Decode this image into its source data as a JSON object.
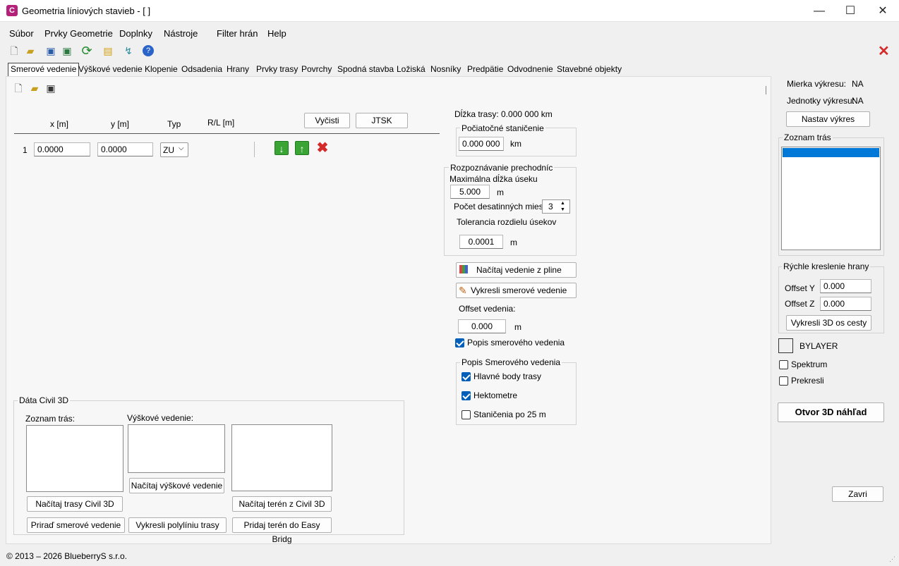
{
  "window": {
    "title": "Geometria líniových stavieb - [ ]",
    "app_icon_text": "C",
    "minimize": "—",
    "maximize": "☐",
    "close": "✕"
  },
  "menu": [
    "Súbor",
    "Prvky Geometrie",
    "Doplnky",
    "Nástroje",
    "Filter hrán",
    "Help"
  ],
  "tabs": [
    "Smerové vedenie",
    "Výškové vedenie",
    "Klopenie",
    "Odsadenia",
    "Hrany",
    "Prvky trasy",
    "Povrchy",
    "Spodná stavba",
    "Ložiská",
    "Nosníky",
    "Predpätie",
    "Odvodnenie",
    "Stavebné objekty"
  ],
  "table": {
    "headers": {
      "x": "x [m]",
      "y": "y  [m]",
      "typ": "Typ",
      "rl": "R/L [m]"
    },
    "rows": [
      {
        "index": "1",
        "x": "0.0000",
        "y": "0.0000",
        "typ": "ZU"
      }
    ],
    "clear_button": "Vyčisti",
    "jtsk_button": "JTSK"
  },
  "trasa": {
    "dlzka": "Dĺžka trasy: 0.000 000 km",
    "pociatocne_title": "Počiatočné staničenie",
    "pociatocne_value": "0.000 000",
    "pociatocne_unit": "km"
  },
  "rozpoznavanie": {
    "title": "Rozpoznávanie prechodníc",
    "max_label": "Maximálna dĺžka úseku",
    "max_value": "5.000",
    "max_unit": "m",
    "desatinne_label": "Počet desatinných miest",
    "desatinne_value": "3",
    "tolerancia_label": "Tolerancia rozdielu úsekov",
    "tolerancia_value": "0.0001",
    "tolerancia_unit": "m"
  },
  "actions": {
    "nacitaj_pline": "Načítaj vedenie z pline",
    "vykresli_smerove": "Vykresli smerové vedenie",
    "offset_label": "Offset vedenia:",
    "offset_value": "0.000",
    "offset_unit": "m",
    "popis_checkbox": "Popis smerového vedenia"
  },
  "popis_group": {
    "title": "Popis Smerového vedenia",
    "hlavne": "Hlavné body trasy",
    "hektometre": "Hektometre",
    "stanicenia": "Staničenia po 25 m"
  },
  "civil3d": {
    "title": "Dáta Civil 3D",
    "zoznam_label": "Zoznam trás:",
    "vyskove_label": "Výškové vedenie:",
    "nacitaj_vyskove": "Načítaj výškové vedenie",
    "nacitaj_trasy": "Načítaj trasy Civil 3D",
    "nacitaj_teren": "Načítaj terén z Civil 3D",
    "prirad": "Priraď smerové vedenie",
    "vykresli_polyliniu": "Vykresli polylíniu trasy",
    "pridaj_teren": "Pridaj terén do Easy Bridg"
  },
  "right": {
    "mierka_label": "Mierka výkresu:",
    "mierka_value": "NA",
    "jednotky_label": "Jednotky výkresu:",
    "jednotky_value": "NA",
    "nastav_button": "Nastav výkres",
    "zoznam_title": "Zoznam trás",
    "rychle_title": "Rýchle kreslenie hrany",
    "offset_y_label": "Offset Y",
    "offset_y_value": "0.000",
    "offset_z_label": "Offset Z",
    "offset_z_value": "0.000",
    "vykresli3d": "Vykresli 3D os cesty",
    "bylayer": "BYLAYER",
    "spektrum": "Spektrum",
    "prekresli": "Prekresli",
    "otvor3d": "Otvor 3D náhľad",
    "zavri": "Zavri"
  },
  "status": "© 2013 – 2026 BlueberryS s.r.o.",
  "colors": {
    "accent": "#005fb8",
    "selection": "#0078d7",
    "app_icon": "#b4217a",
    "down_btn": "#3aa435",
    "delete": "#d42a2a"
  }
}
